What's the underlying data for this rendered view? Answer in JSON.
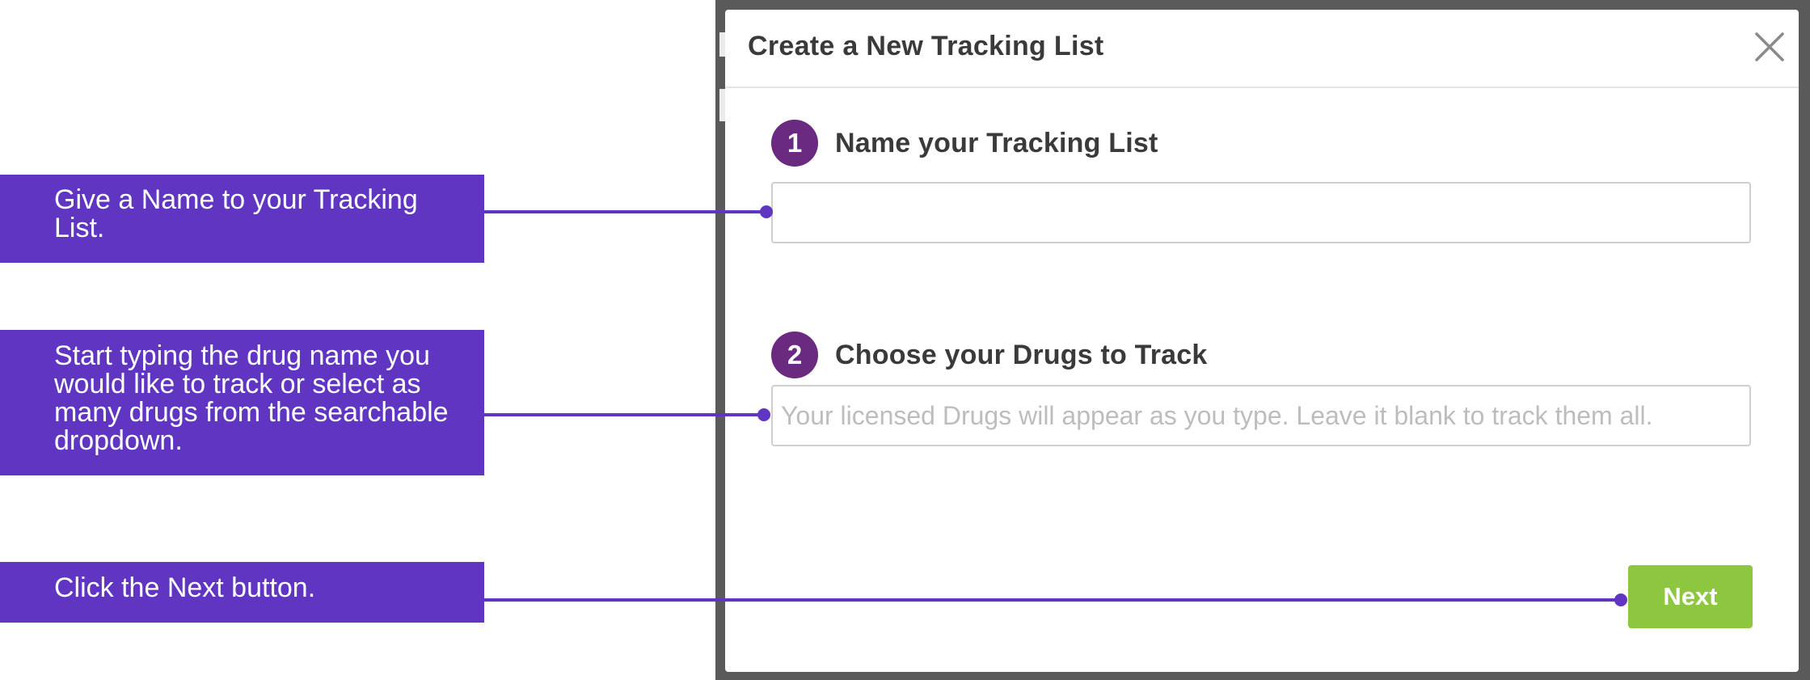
{
  "callouts": [
    {
      "text": "Give a Name to your Tracking\nList."
    },
    {
      "text": "Start typing the drug name you\nwould like to track or select as\nmany drugs from the searchable\ndropdown."
    },
    {
      "text": "Click the Next button."
    }
  ],
  "modal": {
    "title": "Create a New Tracking List",
    "steps": [
      {
        "number": "1",
        "label": "Name your Tracking List",
        "value": "",
        "placeholder": ""
      },
      {
        "number": "2",
        "label": "Choose your Drugs to Track",
        "value": "",
        "placeholder": "Your licensed Drugs will appear as you type. Leave it blank to track them all."
      }
    ],
    "next_label": "Next"
  },
  "colors": {
    "callout_bg": "#5f35c2",
    "connector": "#5f35c2",
    "step_badge": "#6a2a7f",
    "next_button": "#8dc63f",
    "overlay": "#5a5a5a"
  },
  "icons": {
    "close": "close-icon"
  }
}
